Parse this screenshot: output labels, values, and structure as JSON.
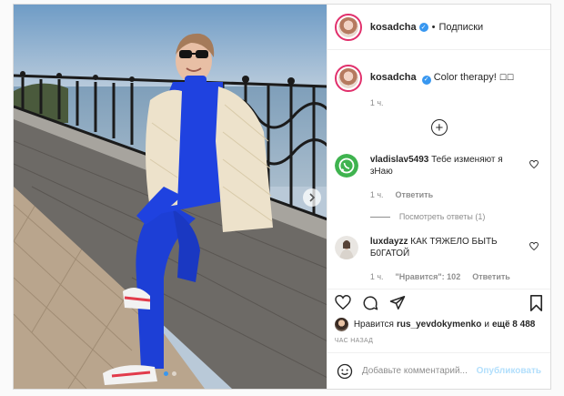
{
  "post": {
    "author": "kosadcha",
    "follow_label": "Подписки",
    "separator": "•",
    "verified_glyph": "✓",
    "caption_text": "Color therapy! ",
    "caption_emoji": "☐☐",
    "caption_time": "1 ч.",
    "load_more_glyph": "+",
    "slide_count": 2,
    "active_slide": 1,
    "next_glyph": "›"
  },
  "comments": [
    {
      "username": "vladislav5493",
      "text": "Тебе изменяют я зНаю",
      "time": "1 ч.",
      "reply_label": "Ответить",
      "view_replies": "Посмотреть ответы (1)",
      "avatar": "whatsapp-icon"
    },
    {
      "username": "luxdayzz",
      "text": "КАК ТЯЖЕЛО БЫТЬ Б0ГАТОЙ",
      "time": "1 ч.",
      "likes": "\"Нравится\": 102",
      "reply_label": "Ответить",
      "avatar": "user-photo"
    }
  ],
  "likes": {
    "prefix": "Нравится",
    "user": "rus_yevdokymenko",
    "middle": "и",
    "others": "ещё 8 488"
  },
  "posted_ago": "ЧАС НАЗАД",
  "comment_box": {
    "placeholder": "Добавьте комментарий...",
    "publish_label": "Опубликовать"
  },
  "colors": {
    "accent": "#3897f0",
    "story_ring": "#e1306c",
    "publish_disabled": "#b2dffc",
    "muted": "#8e8e8e"
  }
}
